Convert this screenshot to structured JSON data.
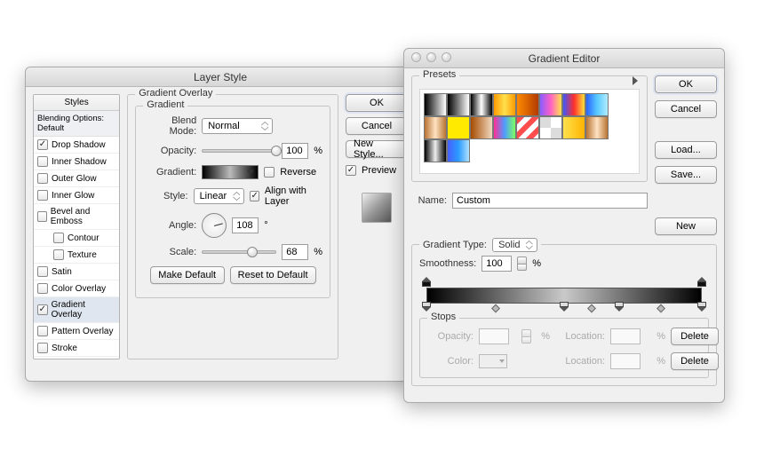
{
  "layerStyle": {
    "title": "Layer Style",
    "stylesHeader": "Styles",
    "blendingOptions": "Blending Options: Default",
    "effects": [
      {
        "label": "Drop Shadow",
        "checked": true
      },
      {
        "label": "Inner Shadow",
        "checked": false
      },
      {
        "label": "Outer Glow",
        "checked": false
      },
      {
        "label": "Inner Glow",
        "checked": false
      },
      {
        "label": "Bevel and Emboss",
        "checked": false
      },
      {
        "label": "Contour",
        "checked": false,
        "indent": true
      },
      {
        "label": "Texture",
        "checked": false,
        "indent": true
      },
      {
        "label": "Satin",
        "checked": false
      },
      {
        "label": "Color Overlay",
        "checked": false
      },
      {
        "label": "Gradient Overlay",
        "checked": true,
        "selected": true
      },
      {
        "label": "Pattern Overlay",
        "checked": false
      },
      {
        "label": "Stroke",
        "checked": false
      }
    ],
    "sectionTitle": "Gradient Overlay",
    "gradientGroup": "Gradient",
    "labels": {
      "blendMode": "Blend Mode:",
      "opacity": "Opacity:",
      "gradient": "Gradient:",
      "style": "Style:",
      "angle": "Angle:",
      "scale": "Scale:",
      "reverse": "Reverse",
      "alignWithLayer": "Align with Layer",
      "percent": "%",
      "degree": "°"
    },
    "values": {
      "blendMode": "Normal",
      "opacity": "100",
      "style": "Linear",
      "alignWithLayer": true,
      "reverse": false,
      "angle": "108",
      "scale": "68"
    },
    "buttons": {
      "makeDefault": "Make Default",
      "resetDefault": "Reset to Default",
      "ok": "OK",
      "cancel": "Cancel",
      "newStyle": "New Style...",
      "preview": "Preview"
    }
  },
  "gradientEditor": {
    "title": "Gradient Editor",
    "presetsLabel": "Presets",
    "presets": [
      "linear-gradient(to right,#000,#fff)",
      "linear-gradient(to right,#000,transparent)",
      "linear-gradient(to right,#000,#fff,#000)",
      "linear-gradient(to right,#ff9a00,#ffe14d,#ff9a00)",
      "linear-gradient(to right,#ff8a00,#b23a00)",
      "linear-gradient(to right,#8a5cff,#ff61c6,#ffe14d)",
      "linear-gradient(to right,#3b58ff,#ff2d2d,#ffe23a)",
      "linear-gradient(to right,#2a64ff,#57c9ff,#b3ecff)",
      "linear-gradient(to right,#b87333,#ffe3c2,#b87333)",
      "linear-gradient(to right,#ffea00,#ffea00)",
      "linear-gradient(to right,#a64b00,#f0d9c0)",
      "linear-gradient(to right,#ff2d95,#4d9dff,#7bff5f)",
      "repeating-linear-gradient(135deg,#ff4d4d 0 6px,#fff 6px 12px)",
      "repeating-conic-gradient(#fff 0 25%,#dcdcdc 0 50%)",
      "linear-gradient(to right,#ffe14d,#ffb400)",
      "linear-gradient(to right,#b87333,#ffe3c2,#b87333)",
      "linear-gradient(to right,#000,#eee,#000)",
      "linear-gradient(to right,#4760ff,#2a9bff,#b0e0ff)"
    ],
    "nameLabel": "Name:",
    "nameValue": "Custom",
    "typeLabel": "Gradient Type:",
    "typeValue": "Solid",
    "smoothLabel": "Smoothness:",
    "smoothValue": "100",
    "percent": "%",
    "stopsLabel": "Stops",
    "opacityLabel": "Opacity:",
    "colorLabel": "Color:",
    "locationLabel": "Location:",
    "buttons": {
      "ok": "OK",
      "cancel": "Cancel",
      "load": "Load...",
      "save": "Save...",
      "new": "New",
      "delete": "Delete"
    },
    "colorStops": [
      0,
      50,
      70,
      100
    ],
    "opacityStops": [
      0,
      100
    ],
    "midpoints": [
      25,
      60,
      85
    ]
  }
}
